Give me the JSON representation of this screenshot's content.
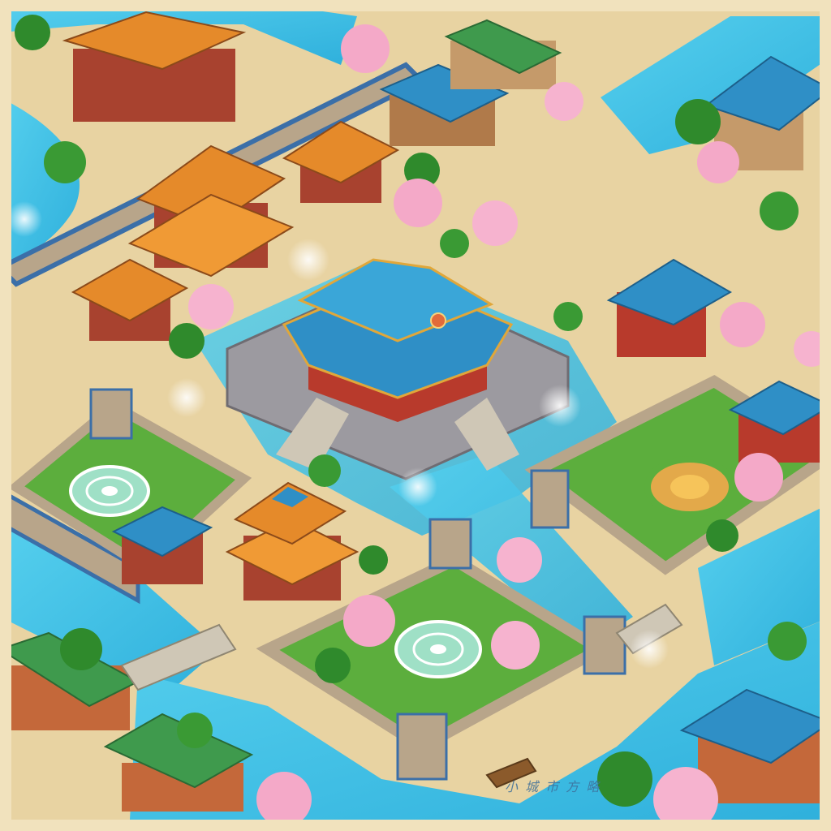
{
  "scene": {
    "kind": "isometric fantasy city map",
    "palette": {
      "water": "#3fc3e8",
      "water_light": "#8fe3f5",
      "ground": "#e8d3a2",
      "grass": "#5cae3d",
      "tree": "#2f8a2c",
      "wall": "#b8a58a",
      "wall_top": "#3b6fa8",
      "roof_blue": "#2f8fc6",
      "roof_orange": "#e58a2a",
      "roof_green": "#3f9a4d",
      "blossom": "#f4a9c8",
      "border": "#f1e2bd"
    },
    "icons": [
      "palace",
      "pagoda",
      "gate-tower",
      "cherry-blossom-tree",
      "garden-emblem",
      "river",
      "bridge",
      "fountain"
    ]
  },
  "watermark": {
    "text": "小 城 市 方 略"
  }
}
